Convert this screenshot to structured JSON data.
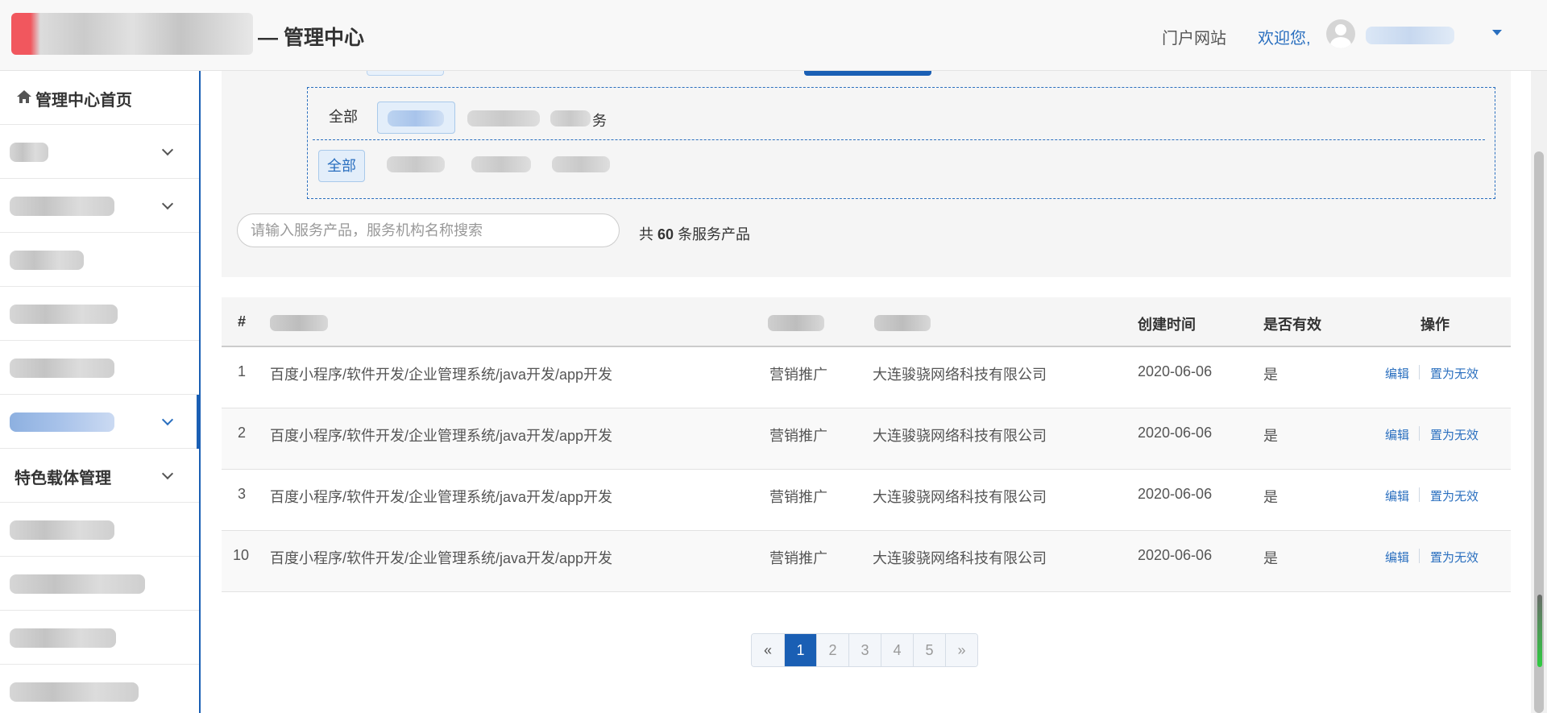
{
  "header": {
    "title": "— 管理中心",
    "portal_link": "门户网站",
    "welcome": "欢迎您,"
  },
  "sidebar": {
    "home": "管理中心首页",
    "items": [
      {
        "label": "",
        "expandable": true
      },
      {
        "label": "",
        "expandable": true
      },
      {
        "label": "",
        "expandable": false
      },
      {
        "label": "",
        "expandable": false
      },
      {
        "label": "",
        "expandable": false
      },
      {
        "label": "",
        "expandable": true,
        "active": true
      },
      {
        "label": "特色载体管理",
        "expandable": true
      },
      {
        "label": "",
        "expandable": false
      },
      {
        "label": "",
        "expandable": false
      },
      {
        "label": "",
        "expandable": false
      },
      {
        "label": "",
        "expandable": false
      }
    ]
  },
  "filters": {
    "row1": {
      "all_label": "全部",
      "tail_text": "务"
    },
    "row2": {
      "all_label": "全部"
    }
  },
  "search": {
    "placeholder": "请输入服务产品，服务机构名称搜索",
    "value": ""
  },
  "count": {
    "prefix": "共",
    "number": "60",
    "suffix": "条服务产品"
  },
  "table": {
    "headers": {
      "index": "#",
      "created": "创建时间",
      "valid": "是否有效",
      "action": "操作"
    },
    "rows": [
      {
        "index": "1",
        "product": "百度小程序/软件开发/企业管理系统/java开发/app开发",
        "type": "营销推广",
        "org": "大连骏骁网络科技有限公司",
        "created": "2020-06-06",
        "valid": "是"
      },
      {
        "index": "2",
        "product": "百度小程序/软件开发/企业管理系统/java开发/app开发",
        "type": "营销推广",
        "org": "大连骏骁网络科技有限公司",
        "created": "2020-06-06",
        "valid": "是"
      },
      {
        "index": "3",
        "product": "百度小程序/软件开发/企业管理系统/java开发/app开发",
        "type": "营销推广",
        "org": "大连骏骁网络科技有限公司",
        "created": "2020-06-06",
        "valid": "是"
      },
      {
        "index": "10",
        "product": "百度小程序/软件开发/企业管理系统/java开发/app开发",
        "type": "营销推广",
        "org": "大连骏骁网络科技有限公司",
        "created": "2020-06-06",
        "valid": "是"
      }
    ],
    "actions": {
      "edit": "编辑",
      "invalidate": "置为无效"
    }
  },
  "pagination": {
    "prev": "«",
    "pages": [
      "1",
      "2",
      "3",
      "4",
      "5"
    ],
    "current": "1",
    "next": "»"
  },
  "colors": {
    "accent": "#1a5fb4",
    "link": "#2a6fbf"
  }
}
